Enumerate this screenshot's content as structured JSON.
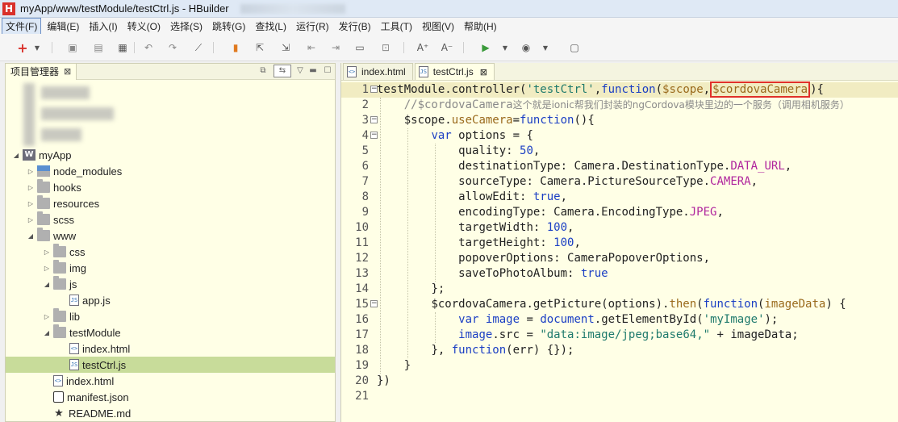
{
  "window": {
    "title": "myApp/www/testModule/testCtrl.js  -  HBuilder",
    "app_icon": "H"
  },
  "menu": [
    "文件(F)",
    "编辑(E)",
    "插入(I)",
    "转义(O)",
    "选择(S)",
    "跳转(G)",
    "查找(L)",
    "运行(R)",
    "发行(B)",
    "工具(T)",
    "视图(V)",
    "帮助(H)"
  ],
  "toolbar_icons": [
    "new-icon",
    "save-icon",
    "save-all-icon",
    "print-icon",
    "undo-icon",
    "redo-icon",
    "format-icon",
    "bookmark-icon",
    "export-icon",
    "import-icon",
    "indent-left-icon",
    "indent-right-icon",
    "preview-icon",
    "close-all-icon",
    "font-increase-icon",
    "font-decrease-icon",
    "run-icon",
    "browser-icon",
    "console-icon"
  ],
  "project_panel": {
    "tab_label": "项目管理器",
    "tree": [
      {
        "label": "myApp",
        "type": "project",
        "depth": 0,
        "arrow": "open"
      },
      {
        "label": "node_modules",
        "type": "node-modules",
        "depth": 1,
        "arrow": "closed"
      },
      {
        "label": "hooks",
        "type": "folder",
        "depth": 1,
        "arrow": "closed"
      },
      {
        "label": "resources",
        "type": "folder",
        "depth": 1,
        "arrow": "closed"
      },
      {
        "label": "scss",
        "type": "folder",
        "depth": 1,
        "arrow": "closed"
      },
      {
        "label": "www",
        "type": "folder",
        "depth": 1,
        "arrow": "open"
      },
      {
        "label": "css",
        "type": "folder",
        "depth": 2,
        "arrow": "closed"
      },
      {
        "label": "img",
        "type": "folder",
        "depth": 2,
        "arrow": "closed"
      },
      {
        "label": "js",
        "type": "folder",
        "depth": 2,
        "arrow": "open"
      },
      {
        "label": "app.js",
        "type": "js",
        "depth": 3,
        "arrow": "none"
      },
      {
        "label": "lib",
        "type": "folder",
        "depth": 2,
        "arrow": "closed"
      },
      {
        "label": "testModule",
        "type": "folder",
        "depth": 2,
        "arrow": "open"
      },
      {
        "label": "index.html",
        "type": "html",
        "depth": 3,
        "arrow": "none"
      },
      {
        "label": "testCtrl.js",
        "type": "js",
        "depth": 3,
        "arrow": "none",
        "selected": true
      },
      {
        "label": "index.html",
        "type": "html",
        "depth": 2,
        "arrow": "none"
      },
      {
        "label": "manifest.json",
        "type": "manifest",
        "depth": 2,
        "arrow": "none"
      },
      {
        "label": "README.md",
        "type": "readme",
        "depth": 2,
        "arrow": "none"
      }
    ]
  },
  "editor": {
    "tabs": [
      {
        "label": "index.html",
        "active": false,
        "icon": "html-file-icon"
      },
      {
        "label": "testCtrl.js",
        "active": true,
        "icon": "js-file-icon"
      }
    ],
    "lines": [
      {
        "n": 1,
        "fold": true,
        "indent": 0,
        "current": true,
        "tokens": [
          [
            "p",
            "testModule.controller("
          ],
          [
            "s",
            "'testCtrl'"
          ],
          [
            "p",
            ","
          ],
          [
            "k",
            "function"
          ],
          [
            "p",
            "("
          ],
          [
            "v",
            "$scope"
          ],
          [
            "p",
            ","
          ],
          [
            "h",
            "$cordovaCamera"
          ],
          [
            "p",
            "){"
          ]
        ]
      },
      {
        "n": 2,
        "fold": false,
        "indent": 1,
        "tokens": [
          [
            "c",
            "//$cordovaCamera"
          ],
          [
            "z",
            "这个就是ionic帮我们封装的ngCordova模块里边的一个服务（调用相机服务）"
          ]
        ]
      },
      {
        "n": 3,
        "fold": true,
        "indent": 1,
        "tokens": [
          [
            "p",
            "$scope."
          ],
          [
            "v",
            "useCamera"
          ],
          [
            "p",
            "="
          ],
          [
            "k",
            "function"
          ],
          [
            "p",
            "(){"
          ]
        ]
      },
      {
        "n": 4,
        "fold": true,
        "indent": 2,
        "tokens": [
          [
            "k",
            "var"
          ],
          [
            "p",
            " options = {"
          ]
        ]
      },
      {
        "n": 5,
        "fold": false,
        "indent": 3,
        "tokens": [
          [
            "p",
            "quality: "
          ],
          [
            "n",
            "50"
          ],
          [
            "p",
            ","
          ]
        ]
      },
      {
        "n": 6,
        "fold": false,
        "indent": 3,
        "tokens": [
          [
            "p",
            "destinationType: Camera.DestinationType."
          ],
          [
            "m",
            "DATA_URL"
          ],
          [
            "p",
            ","
          ]
        ]
      },
      {
        "n": 7,
        "fold": false,
        "indent": 3,
        "tokens": [
          [
            "p",
            "sourceType: Camera.PictureSourceType."
          ],
          [
            "m",
            "CAMERA"
          ],
          [
            "p",
            ","
          ]
        ]
      },
      {
        "n": 8,
        "fold": false,
        "indent": 3,
        "tokens": [
          [
            "p",
            "allowEdit: "
          ],
          [
            "k",
            "true"
          ],
          [
            "p",
            ","
          ]
        ]
      },
      {
        "n": 9,
        "fold": false,
        "indent": 3,
        "tokens": [
          [
            "p",
            "encodingType: Camera.EncodingType."
          ],
          [
            "m",
            "JPEG"
          ],
          [
            "p",
            ","
          ]
        ]
      },
      {
        "n": 10,
        "fold": false,
        "indent": 3,
        "tokens": [
          [
            "p",
            "targetWidth: "
          ],
          [
            "n",
            "100"
          ],
          [
            "p",
            ","
          ]
        ]
      },
      {
        "n": 11,
        "fold": false,
        "indent": 3,
        "tokens": [
          [
            "p",
            "targetHeight: "
          ],
          [
            "n",
            "100"
          ],
          [
            "p",
            ","
          ]
        ]
      },
      {
        "n": 12,
        "fold": false,
        "indent": 3,
        "tokens": [
          [
            "p",
            "popoverOptions: CameraPopoverOptions,"
          ]
        ]
      },
      {
        "n": 13,
        "fold": false,
        "indent": 3,
        "tokens": [
          [
            "p",
            "saveToPhotoAlbum: "
          ],
          [
            "k",
            "true"
          ]
        ]
      },
      {
        "n": 14,
        "fold": false,
        "indent": 2,
        "tokens": [
          [
            "p",
            "};"
          ]
        ]
      },
      {
        "n": 15,
        "fold": true,
        "indent": 2,
        "tokens": [
          [
            "p",
            "$cordovaCamera.getPicture(options)."
          ],
          [
            "v",
            "then"
          ],
          [
            "p",
            "("
          ],
          [
            "k",
            "function"
          ],
          [
            "p",
            "("
          ],
          [
            "v",
            "imageData"
          ],
          [
            "p",
            ") {"
          ]
        ]
      },
      {
        "n": 16,
        "fold": false,
        "indent": 3,
        "tokens": [
          [
            "k",
            "var"
          ],
          [
            "p",
            " "
          ],
          [
            "k",
            "image"
          ],
          [
            "p",
            " = "
          ],
          [
            "k",
            "document"
          ],
          [
            "p",
            ".getElementById("
          ],
          [
            "s",
            "'myImage'"
          ],
          [
            "p",
            ");"
          ]
        ]
      },
      {
        "n": 17,
        "fold": false,
        "indent": 3,
        "tokens": [
          [
            "k",
            "image"
          ],
          [
            "p",
            ".src = "
          ],
          [
            "s",
            "\"data:image/jpeg;base64,\""
          ],
          [
            "p",
            " + imageData;"
          ]
        ]
      },
      {
        "n": 18,
        "fold": false,
        "indent": 2,
        "tokens": [
          [
            "p",
            "}, "
          ],
          [
            "k",
            "function"
          ],
          [
            "p",
            "(err) {});"
          ]
        ]
      },
      {
        "n": 19,
        "fold": false,
        "indent": 1,
        "tokens": [
          [
            "p",
            "}"
          ]
        ]
      },
      {
        "n": 20,
        "fold": false,
        "indent": 0,
        "tokens": [
          [
            "p",
            "})"
          ]
        ]
      },
      {
        "n": 21,
        "fold": false,
        "indent": 0,
        "tokens": []
      }
    ]
  },
  "colors": {
    "editor_bg": "#ffffe6",
    "current_line": "#f1ecc2",
    "keyword": "#1b3fc4",
    "string": "#1f7a6c",
    "variable": "#9a6a1c",
    "constant": "#b0259d",
    "highlight_box": "#e0302a",
    "selected_row": "#c8dc9a"
  }
}
